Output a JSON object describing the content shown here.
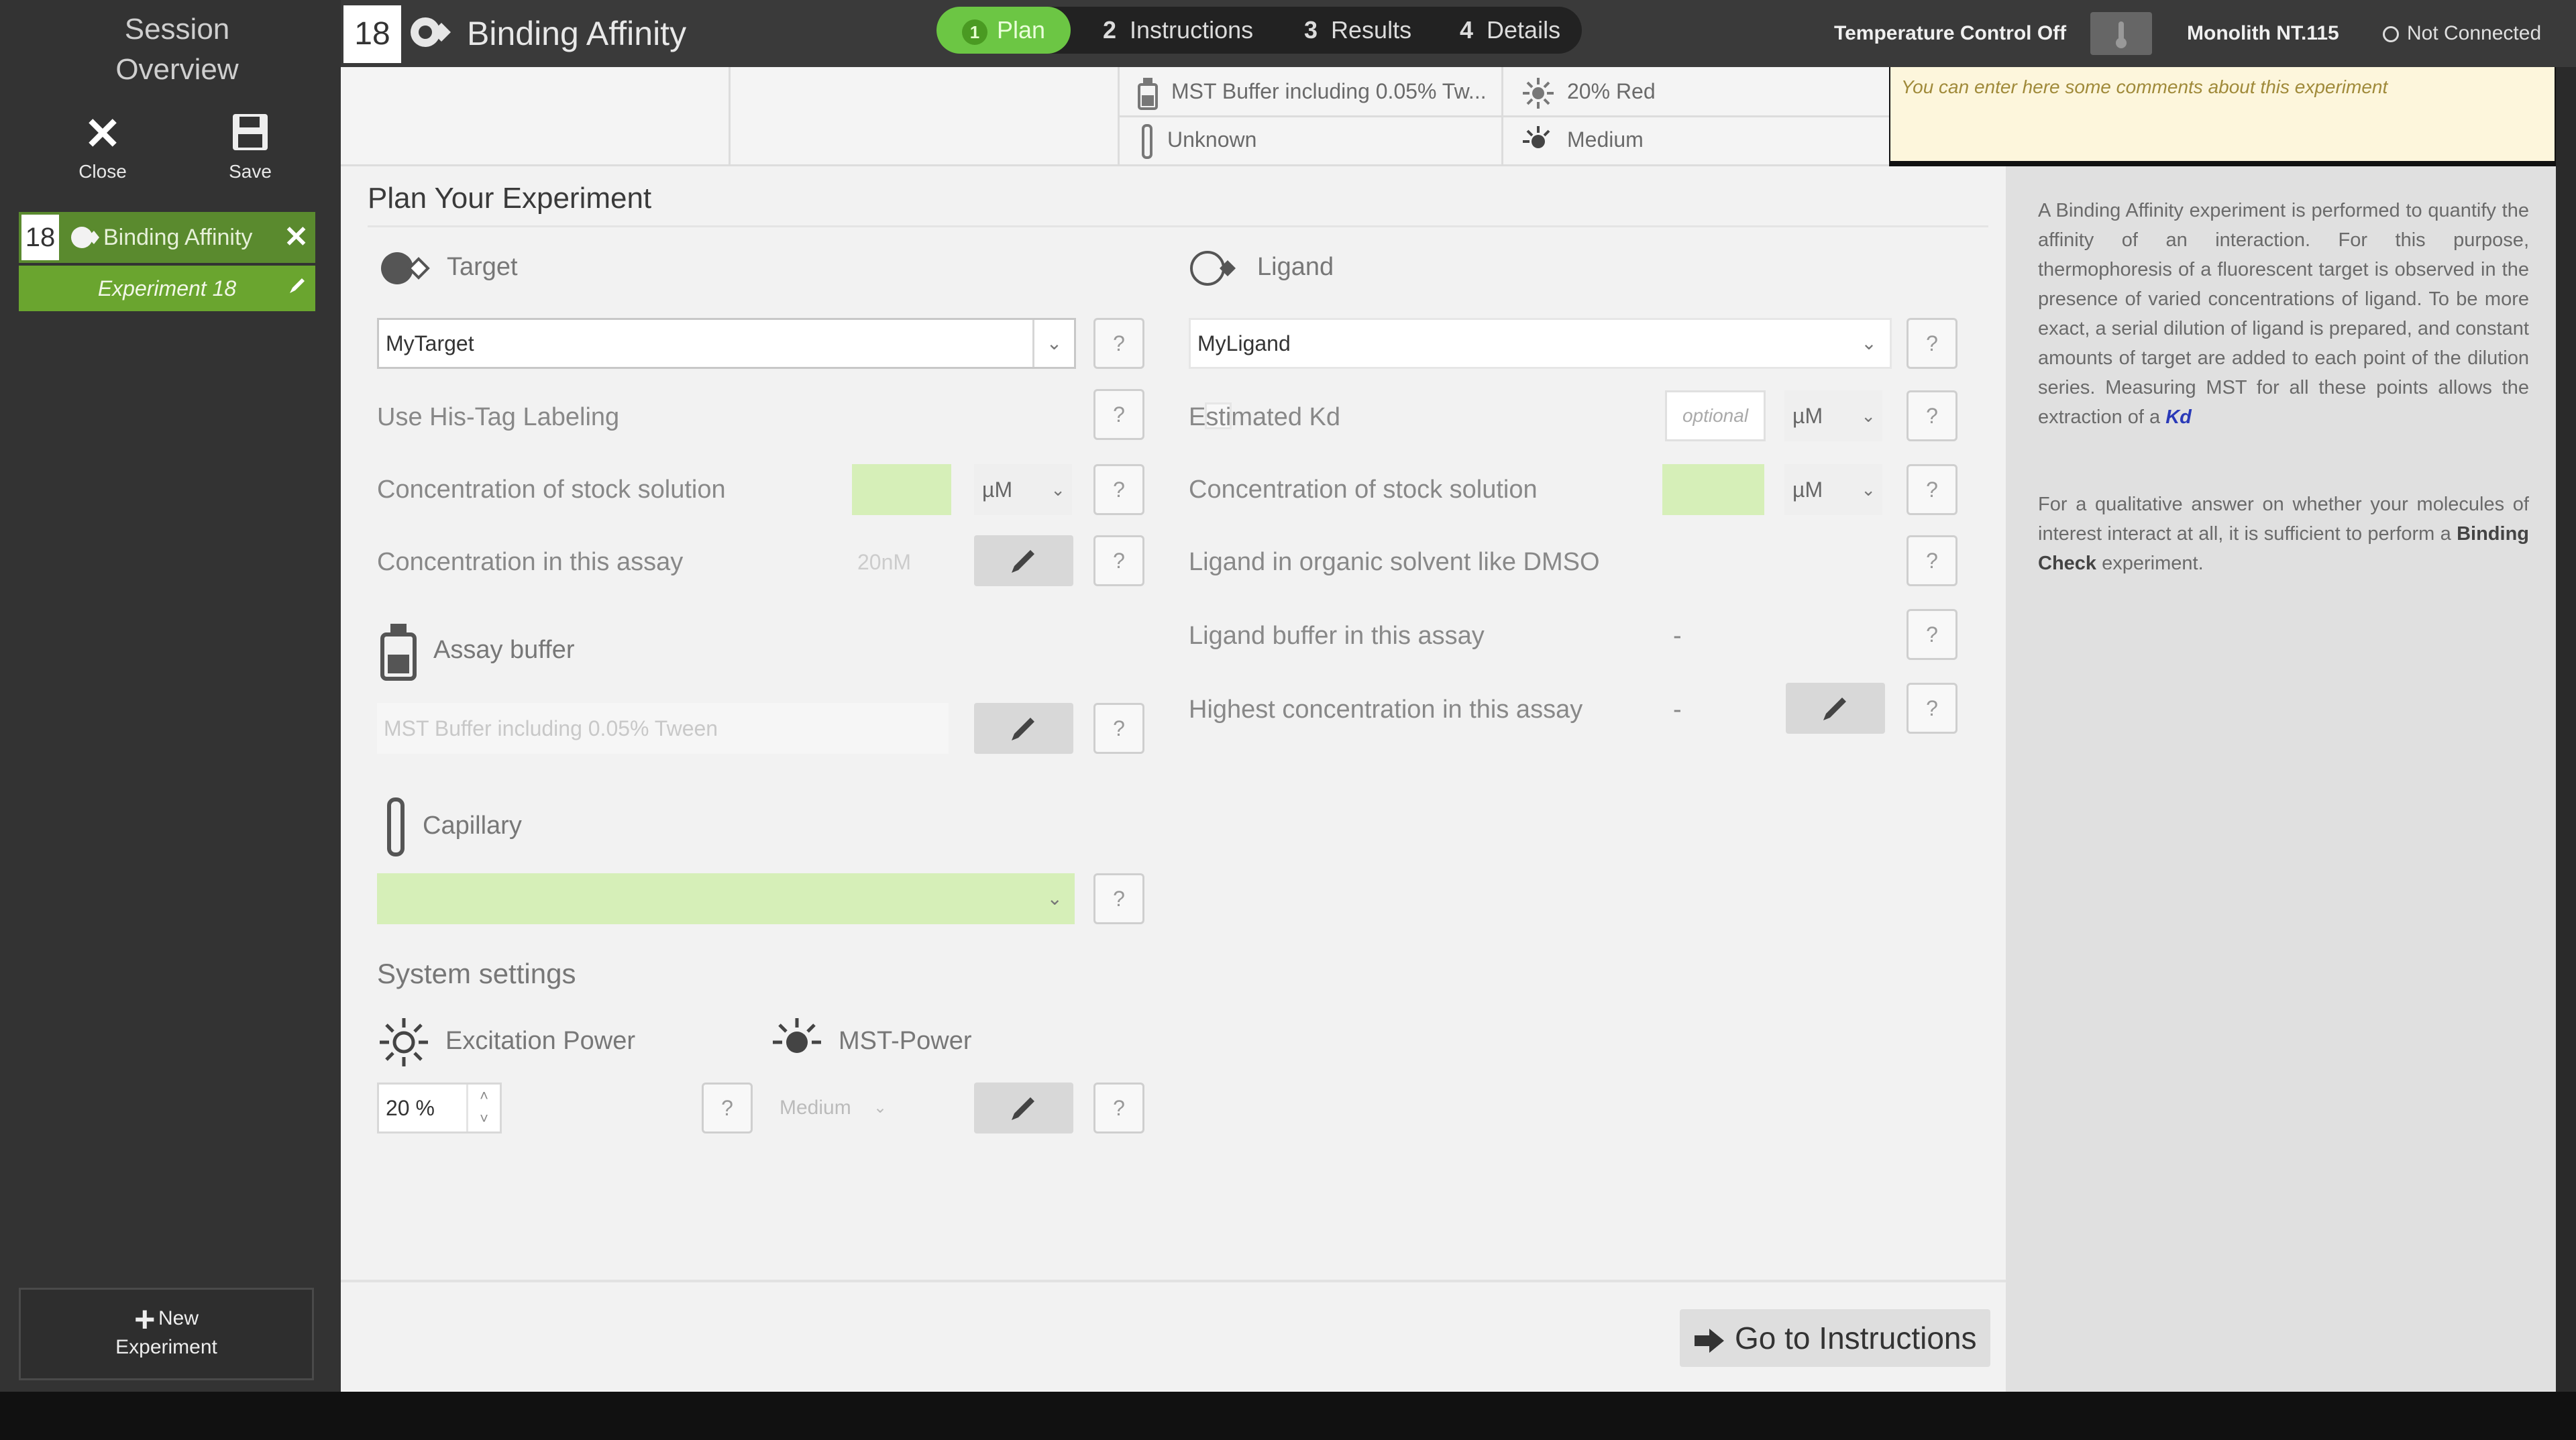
{
  "sidebar": {
    "session_line1": "Session",
    "session_line2": "Overview",
    "close_label": "Close",
    "save_label": "Save",
    "experiment": {
      "number": "18",
      "title": "Binding Affinity",
      "subtitle": "Experiment 18"
    },
    "new_line1": "New",
    "new_line2": "Experiment"
  },
  "header": {
    "number": "18",
    "title": "Binding Affinity",
    "tabs": [
      {
        "num": "1",
        "label": "Plan"
      },
      {
        "num": "2",
        "label": "Instructions"
      },
      {
        "num": "3",
        "label": "Results"
      },
      {
        "num": "4",
        "label": "Details"
      }
    ],
    "temperature": "Temperature Control Off",
    "instrument": "Monolith NT.115",
    "connection": "Not Connected"
  },
  "summary": {
    "buffer": "MST Buffer including 0.05% Tw...",
    "capillary": "Unknown",
    "excitation": "20% Red",
    "mst_power": "Medium",
    "comment_placeholder": "You can enter here some comments about this experiment"
  },
  "plan": {
    "title": "Plan Your Experiment",
    "target": {
      "heading": "Target",
      "value": "MyTarget",
      "his_tag_label": "Use His-Tag Labeling",
      "stock_label": "Concentration of stock solution",
      "stock_unit": "µM",
      "assay_label": "Concentration in this assay",
      "assay_value": "20nM"
    },
    "assay_buffer": {
      "heading": "Assay buffer",
      "value": "MST Buffer including 0.05% Tween"
    },
    "capillary": {
      "heading": "Capillary"
    },
    "system": {
      "heading": "System settings",
      "excitation_heading": "Excitation Power",
      "excitation_value": "20 %",
      "mst_heading": "MST-Power",
      "mst_value": "Medium"
    },
    "ligand": {
      "heading": "Ligand",
      "value": "MyLigand",
      "kd_label": "Estimated Kd",
      "kd_placeholder": "optional",
      "kd_unit": "µM",
      "stock_label": "Concentration of stock solution",
      "stock_unit": "µM",
      "dmso_label": "Ligand in organic solvent like DMSO",
      "buffer_label": "Ligand buffer in this assay",
      "buffer_value": "-",
      "highest_label": "Highest concentration in this assay",
      "highest_value": "-"
    },
    "help_btn": "?",
    "go_button": "Go to Instructions"
  },
  "help": {
    "p1_text": "A Binding Affinity experiment is performed to quantify the affinity of an interaction. For this purpose, thermophoresis of a fluorescent target is observed in the presence of varied concentrations of ligand. To be more exact, a serial dilution of ligand is prepared, and constant amounts of target are added to each point of the dilution series. Measuring MST for all these points allows the extraction of a",
    "p1_link": "Kd",
    "p2_text": "For a qualitative answer on whether your molecules of interest interact at all, it is sufficient to perform a",
    "p2_bold": "Binding Check",
    "p2_end": "experiment."
  },
  "colors": {
    "accent_green": "#6cc644",
    "sidebar_dark": "#333333",
    "field_green": "#d6efb8",
    "comment_bg": "#fdf6dc"
  }
}
